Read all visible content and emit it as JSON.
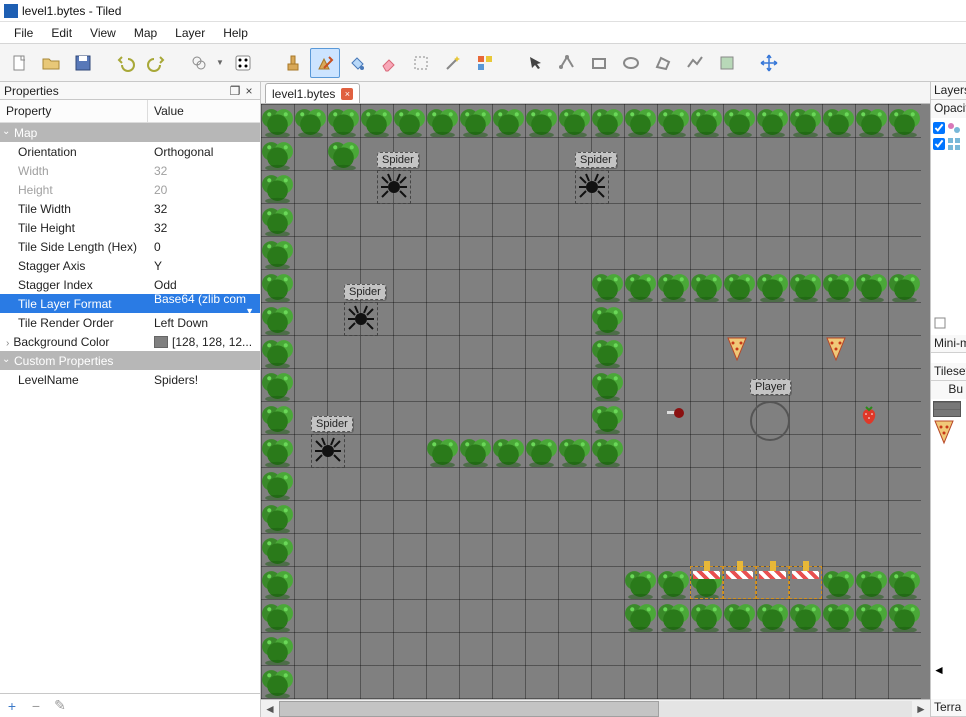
{
  "window": {
    "title": "level1.bytes - Tiled"
  },
  "menu": [
    "File",
    "Edit",
    "View",
    "Map",
    "Layer",
    "Help"
  ],
  "tabs": [
    {
      "label": "level1.bytes"
    }
  ],
  "panels": {
    "properties": {
      "title": "Properties",
      "columns": [
        "Property",
        "Value"
      ],
      "groups": [
        {
          "name": "Map",
          "rows": [
            {
              "k": "Orientation",
              "v": "Orthogonal",
              "dim": false
            },
            {
              "k": "Width",
              "v": "32",
              "dim": true
            },
            {
              "k": "Height",
              "v": "20",
              "dim": true
            },
            {
              "k": "Tile Width",
              "v": "32",
              "dim": false
            },
            {
              "k": "Tile Height",
              "v": "32",
              "dim": false
            },
            {
              "k": "Tile Side Length (Hex)",
              "v": "0",
              "dim": false
            },
            {
              "k": "Stagger Axis",
              "v": "Y",
              "dim": false
            },
            {
              "k": "Stagger Index",
              "v": "Odd",
              "dim": false
            },
            {
              "k": "Tile Layer Format",
              "v": "Base64 (zlib com",
              "selected": true,
              "dropdown": true
            },
            {
              "k": "Tile Render Order",
              "v": "Left Down",
              "dim": false
            },
            {
              "k": "Background Color",
              "v": "[128, 128, 12...",
              "swatch": true,
              "expandable": true
            }
          ]
        },
        {
          "name": "Custom Properties",
          "rows": [
            {
              "k": "LevelName",
              "v": "Spiders!"
            }
          ]
        }
      ]
    },
    "right": {
      "layers": "Layers",
      "opacity": "Opacity",
      "minimap": "Mini-m",
      "tilesets": "Tilesets",
      "bu": "Bu",
      "terra": "Terra"
    }
  },
  "map": {
    "objects": {
      "spider_label": "Spider",
      "player_label": "Player"
    },
    "bushes_top_row_y": 0,
    "bushes_left_col_x": 0
  },
  "icons": {
    "pop_out": "❐",
    "close": "×",
    "plus": "+",
    "minus": "−",
    "pencil": "✎"
  }
}
